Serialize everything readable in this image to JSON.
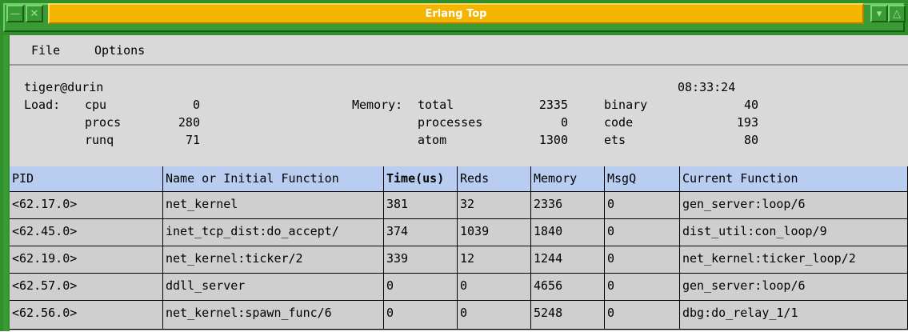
{
  "window": {
    "title": "Erlang Top",
    "buttons": [
      "minimize-icon",
      "close-icon",
      "menu-icon",
      "maximize-icon"
    ]
  },
  "menu": {
    "items": [
      "File",
      "Options"
    ]
  },
  "info": {
    "node": "tiger@durin",
    "time": "08:33:24",
    "load_label": "Load:",
    "cpu_label": "cpu",
    "cpu_value": "0",
    "procs_label": "procs",
    "procs_value": "280",
    "runq_label": "runq",
    "runq_value": "71",
    "memory_label": "Memory:",
    "total_label": "total",
    "total_value": "2335",
    "processes_label": "processes",
    "processes_value": "0",
    "atom_label": "atom",
    "atom_value": "1300",
    "binary_label": "binary",
    "binary_value": "40",
    "code_label": "code",
    "code_value": "193",
    "ets_label": "ets",
    "ets_value": "80"
  },
  "table": {
    "headers": [
      "PID",
      "Name or Initial Function",
      "Time(us)",
      "Reds",
      "Memory",
      "MsgQ",
      "Current Function"
    ],
    "rows": [
      [
        "<62.17.0>",
        "net_kernel",
        "381",
        "32",
        "2336",
        "0",
        "gen_server:loop/6"
      ],
      [
        "<62.45.0>",
        "inet_tcp_dist:do_accept/",
        "374",
        "1039",
        "1840",
        "0",
        "dist_util:con_loop/9"
      ],
      [
        "<62.19.0>",
        "net_kernel:ticker/2",
        "339",
        "12",
        "1244",
        "0",
        "net_kernel:ticker_loop/2"
      ],
      [
        "<62.57.0>",
        "ddll_server",
        "0",
        "0",
        "4656",
        "0",
        "gen_server:loop/6"
      ],
      [
        "<62.56.0>",
        "net_kernel:spawn_func/6",
        "0",
        "0",
        "5248",
        "0",
        "dbg:do_relay_1/1"
      ]
    ]
  },
  "colors": {
    "frame": "#2f8f2a",
    "title_strip": "#f5b400",
    "header_bg": "#b8cdf0",
    "row_bg": "#cfcfcf"
  }
}
